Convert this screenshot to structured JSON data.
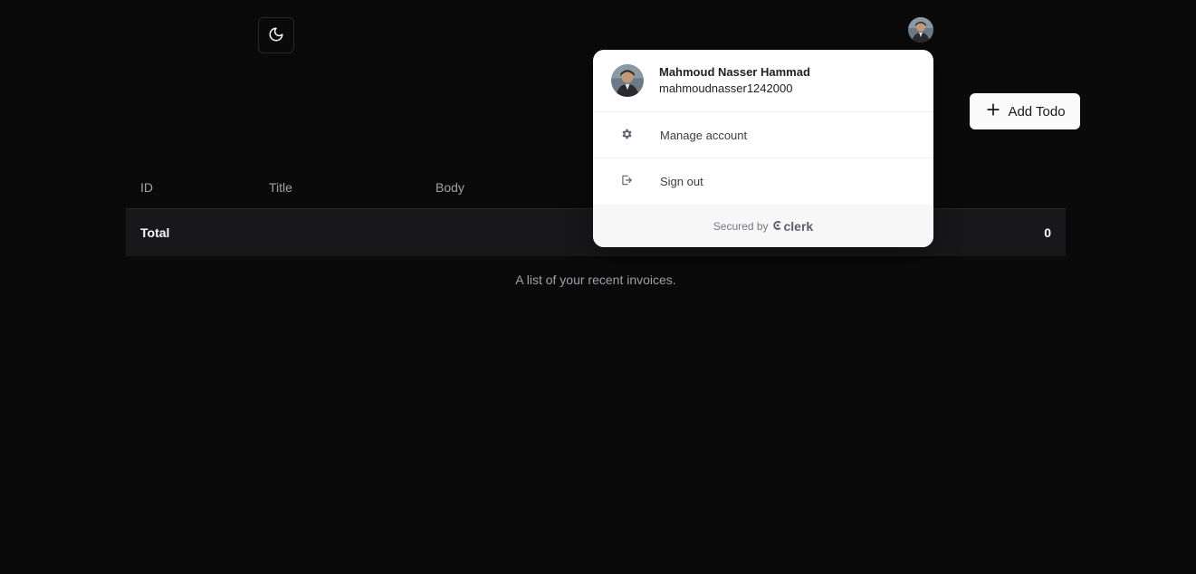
{
  "header": {
    "theme_toggle_icon": "moon-icon",
    "avatar_icon": "user-avatar"
  },
  "toolbar": {
    "add_todo_label": "Add Todo",
    "add_icon": "plus-icon"
  },
  "table": {
    "columns": [
      "ID",
      "Title",
      "Body"
    ],
    "footer_label": "Total",
    "footer_value": "0",
    "caption": "A list of your recent invoices."
  },
  "user_menu": {
    "name": "Mahmoud Nasser Hammad",
    "username": "mahmoudnasser1242000",
    "actions": [
      {
        "label": "Manage account",
        "icon": "gear-icon"
      },
      {
        "label": "Sign out",
        "icon": "sign-out-icon"
      }
    ],
    "footer_prefix": "Secured by",
    "footer_brand": "clerk"
  },
  "colors": {
    "background": "#0a0a0a",
    "popover_bg": "#ffffff",
    "button_bg": "#fafafa"
  }
}
